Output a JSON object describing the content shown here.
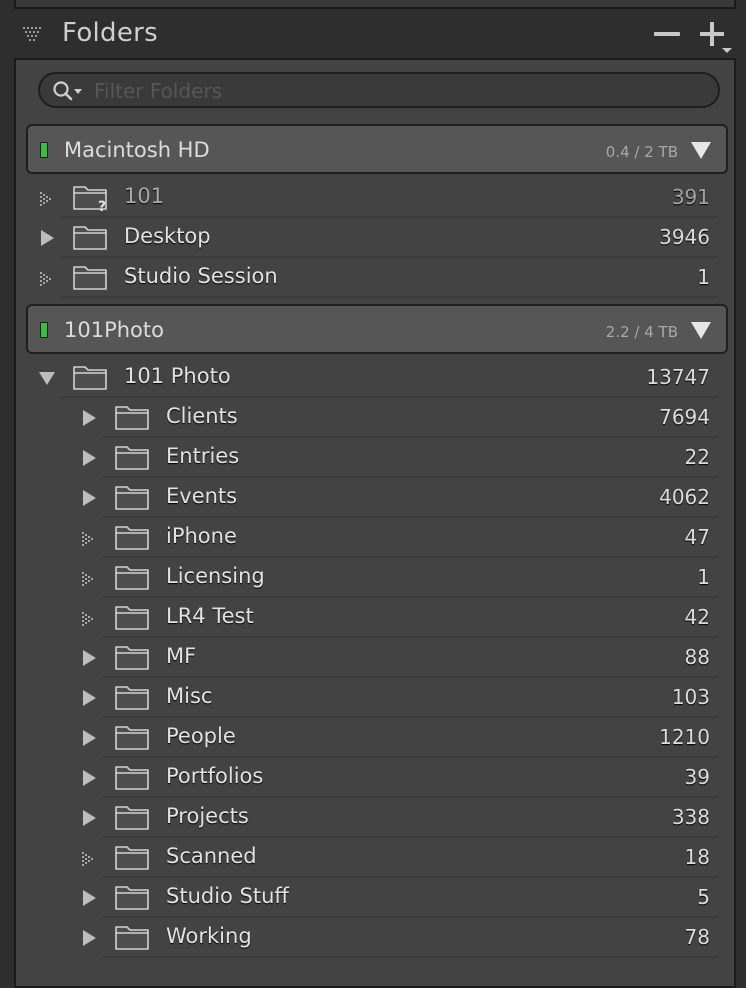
{
  "header": {
    "title": "Folders",
    "collapse_icon": "collapse-triangle-icon",
    "minus_icon": "minus-icon",
    "plus_icon": "plus-icon"
  },
  "search": {
    "placeholder": "Filter Folders",
    "value": ""
  },
  "colors": {
    "led": "#3fb84a",
    "panel_bg": "#434343",
    "volume_bg": "#565656"
  },
  "volumes": [
    {
      "name": "Macintosh HD",
      "size": "0.4 / 2 TB",
      "folders": [
        {
          "name": "101",
          "count": "391",
          "disclosure": "none",
          "missing": true
        },
        {
          "name": "Desktop",
          "count": "3946",
          "disclosure": "collapsed",
          "missing": false
        },
        {
          "name": "Studio Session",
          "count": "1",
          "disclosure": "none",
          "missing": false
        }
      ]
    },
    {
      "name": "101Photo",
      "size": "2.2 / 4 TB",
      "folders": [
        {
          "name": "101 Photo",
          "count": "13747",
          "disclosure": "expanded",
          "missing": false
        },
        {
          "name": "Clients",
          "count": "7694",
          "disclosure": "collapsed",
          "missing": false
        },
        {
          "name": "Entries",
          "count": "22",
          "disclosure": "collapsed",
          "missing": false
        },
        {
          "name": "Events",
          "count": "4062",
          "disclosure": "collapsed",
          "missing": false
        },
        {
          "name": "iPhone",
          "count": "47",
          "disclosure": "none",
          "missing": false
        },
        {
          "name": "Licensing",
          "count": "1",
          "disclosure": "none",
          "missing": false
        },
        {
          "name": "LR4 Test",
          "count": "42",
          "disclosure": "none",
          "missing": false
        },
        {
          "name": "MF",
          "count": "88",
          "disclosure": "collapsed",
          "missing": false
        },
        {
          "name": "Misc",
          "count": "103",
          "disclosure": "collapsed",
          "missing": false
        },
        {
          "name": "People",
          "count": "1210",
          "disclosure": "collapsed",
          "missing": false
        },
        {
          "name": "Portfolios",
          "count": "39",
          "disclosure": "collapsed",
          "missing": false
        },
        {
          "name": "Projects",
          "count": "338",
          "disclosure": "collapsed",
          "missing": false
        },
        {
          "name": "Scanned",
          "count": "18",
          "disclosure": "none",
          "missing": false
        },
        {
          "name": "Studio Stuff",
          "count": "5",
          "disclosure": "collapsed",
          "missing": false
        },
        {
          "name": "Working",
          "count": "78",
          "disclosure": "collapsed",
          "missing": false
        }
      ]
    }
  ]
}
